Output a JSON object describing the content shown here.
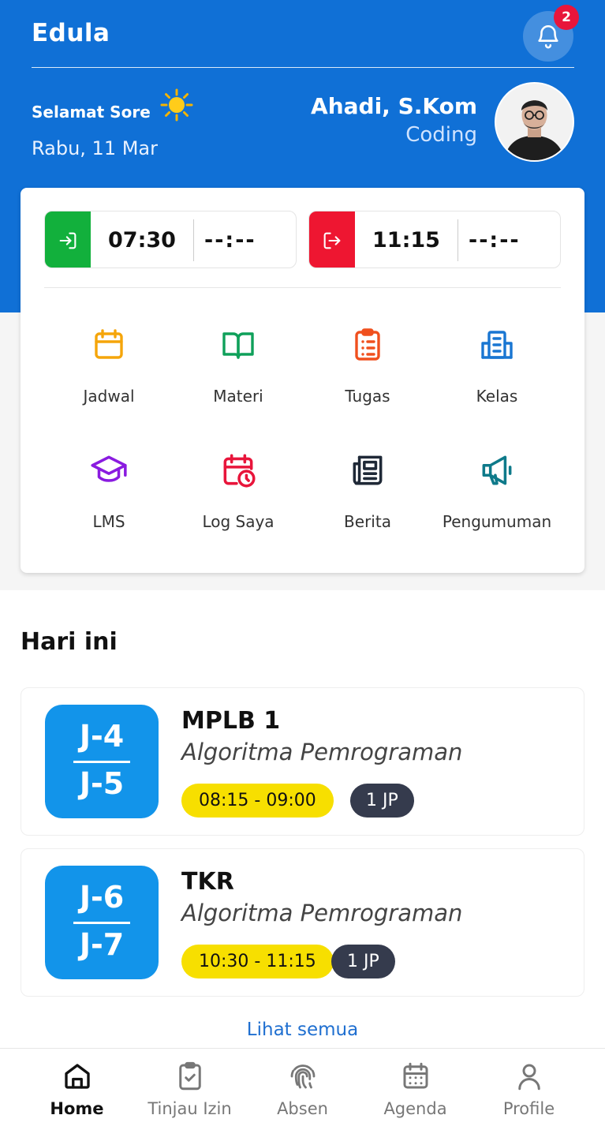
{
  "app": {
    "title": "Edula"
  },
  "notifications": {
    "count": "2"
  },
  "greeting": {
    "text": "Selamat Sore",
    "date": "Rabu, 11 Mar"
  },
  "user": {
    "name": "Ahadi, S.Kom",
    "role": "Coding"
  },
  "attendance": {
    "check_in": {
      "scheduled": "07:30",
      "actual": "--:--",
      "color": "#12b03c"
    },
    "check_out": {
      "scheduled": "11:15",
      "actual": "--:--",
      "color": "#ee1631"
    }
  },
  "menu": [
    {
      "label": "Jadwal",
      "icon": "calendar-icon",
      "color": "#f5a50a"
    },
    {
      "label": "Materi",
      "icon": "book-open-icon",
      "color": "#0fa05a"
    },
    {
      "label": "Tugas",
      "icon": "clipboard-list-icon",
      "color": "#f0501e"
    },
    {
      "label": "Kelas",
      "icon": "building-icon",
      "color": "#1976d2"
    },
    {
      "label": "LMS",
      "icon": "graduation-cap-icon",
      "color": "#8a1be0"
    },
    {
      "label": "Log Saya",
      "icon": "calendar-clock-icon",
      "color": "#e8153b"
    },
    {
      "label": "Berita",
      "icon": "newspaper-icon",
      "color": "#1f2937"
    },
    {
      "label": "Pengumuman",
      "icon": "megaphone-icon",
      "color": "#0e7a8a"
    }
  ],
  "today": {
    "title": "Hari ini",
    "items": [
      {
        "period_start": "J-4",
        "period_end": "J-5",
        "class": "MPLB 1",
        "subject": "Algoritma Pemrograman",
        "time": "08:15 - 09:00",
        "jp": "1 JP"
      },
      {
        "period_start": "J-6",
        "period_end": "J-7",
        "class": "TKR",
        "subject": "Algoritma Pemrograman",
        "time": "10:30 - 11:15",
        "jp": "1 JP"
      }
    ],
    "see_all": "Lihat semua"
  },
  "nav": [
    {
      "label": "Home",
      "icon": "home-icon",
      "active": true
    },
    {
      "label": "Tinjau Izin",
      "icon": "clipboard-check-icon",
      "active": false
    },
    {
      "label": "Absen",
      "icon": "fingerprint-icon",
      "active": false
    },
    {
      "label": "Agenda",
      "icon": "calendar-grid-icon",
      "active": false
    },
    {
      "label": "Profile",
      "icon": "user-icon",
      "active": false
    }
  ],
  "colors": {
    "primary": "#1070d6",
    "period_box": "#1294ea",
    "time_pill": "#f7df00",
    "jp_pill": "#353b4d"
  }
}
